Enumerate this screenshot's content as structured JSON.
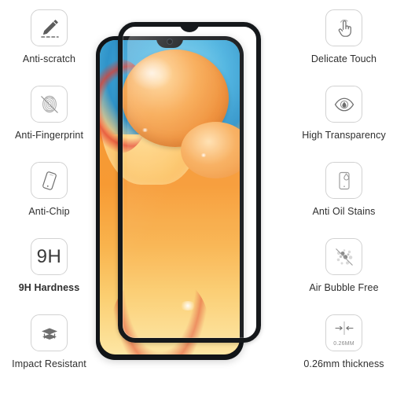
{
  "product": {
    "type": "tempered-glass-screen-protector",
    "thickness_badge": "0.26MM",
    "hardness_badge": "9H"
  },
  "features_left": [
    {
      "icon": "pen-scratch-icon",
      "label": "Anti-scratch",
      "bold": false
    },
    {
      "icon": "fingerprint-slash-icon",
      "label": "Anti-Fingerprint",
      "bold": false
    },
    {
      "icon": "tilted-phone-icon",
      "label": "Anti-Chip",
      "bold": false
    },
    {
      "icon": "hardness-9h-icon",
      "label": "9H Hardness",
      "bold": true
    },
    {
      "icon": "impact-layers-icon",
      "label": "Impact Resistant",
      "bold": false
    }
  ],
  "features_right": [
    {
      "icon": "touch-hand-icon",
      "label": "Delicate Touch",
      "bold": false
    },
    {
      "icon": "eye-icon",
      "label": "High Transparency",
      "bold": false
    },
    {
      "icon": "oil-drop-phone-icon",
      "label": "Anti Oil Stains",
      "bold": false
    },
    {
      "icon": "bubbles-slash-icon",
      "label": "Air Bubble Free",
      "bold": false
    },
    {
      "icon": "thickness-arrows-icon",
      "label": "0.26mm thickness",
      "bold": false
    }
  ],
  "colors": {
    "background": "#ffffff",
    "text": "#2f2f2f",
    "icon_stroke": "#6e6e6e",
    "icon_border": "#d2d2d2",
    "phone_frame": "#111417",
    "wallpaper_orange": "#f59a36",
    "wallpaper_blue": "#49b2e0"
  }
}
